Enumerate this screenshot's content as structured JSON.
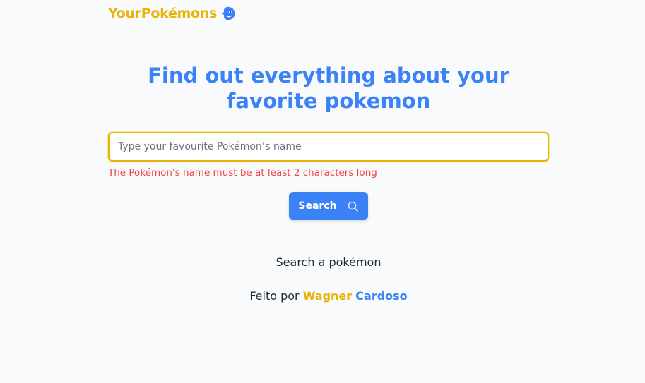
{
  "header": {
    "logo_text": "YourPokémons",
    "logo_icon": "pokemon-head-icon"
  },
  "hero": {
    "title": "Find out everything about your favorite pokemon"
  },
  "search": {
    "placeholder": "Type your favourite Pokémon’s name",
    "value": "",
    "error": "The Pokémon's name must be at least 2 characters long",
    "button_label": "Search",
    "button_icon": "search-icon"
  },
  "status": {
    "message": "Search a pokémon"
  },
  "footer": {
    "prefix": "Feito por",
    "author_first": "Wagner",
    "author_last": "Cardoso"
  },
  "colors": {
    "primary": "#3b82f6",
    "accent": "#eab308",
    "error": "#ef4444",
    "background": "#f8fafc"
  }
}
